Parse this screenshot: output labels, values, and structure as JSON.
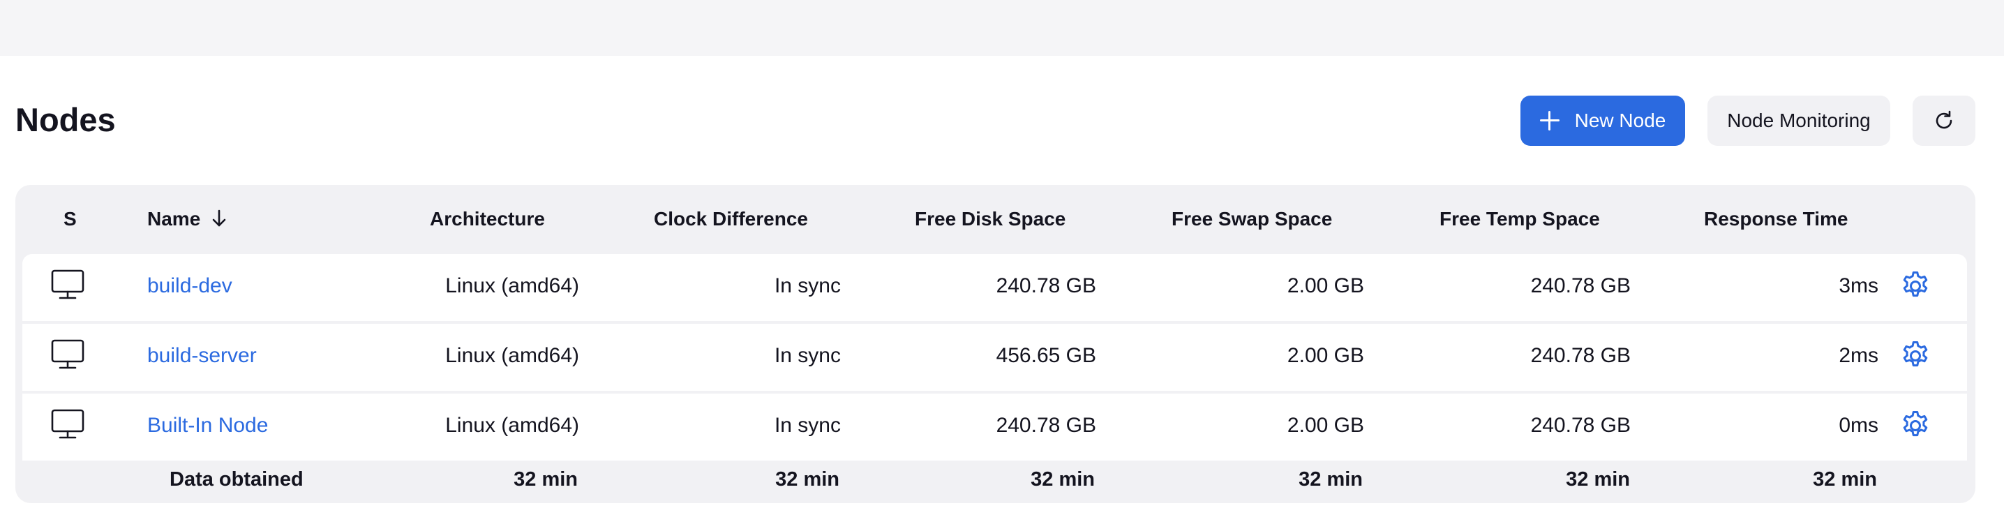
{
  "header": {
    "title": "Nodes",
    "new_node_label": "New Node",
    "monitoring_label": "Node Monitoring",
    "refresh_icon": "refresh-icon",
    "new_icon": "plus-icon"
  },
  "accent_color": "#2b6ae0",
  "table": {
    "columns": {
      "status": "S",
      "name": "Name",
      "architecture": "Architecture",
      "clock": "Clock Difference",
      "disk": "Free Disk Space",
      "swap": "Free Swap Space",
      "temp": "Free Temp Space",
      "response": "Response Time"
    },
    "sort_icon": "arrow-down-icon",
    "rows": [
      {
        "status_icon": "computer-icon",
        "name": "build-dev",
        "architecture": "Linux (amd64)",
        "clock": "In sync",
        "disk": "240.78 GB",
        "swap": "2.00 GB",
        "temp": "240.78 GB",
        "response": "3ms",
        "action_icon": "gear-icon"
      },
      {
        "status_icon": "computer-icon",
        "name": "build-server",
        "architecture": "Linux (amd64)",
        "clock": "In sync",
        "disk": "456.65 GB",
        "swap": "2.00 GB",
        "temp": "240.78 GB",
        "response": "2ms",
        "action_icon": "gear-icon"
      },
      {
        "status_icon": "computer-icon",
        "name": "Built-In Node",
        "architecture": "Linux (amd64)",
        "clock": "In sync",
        "disk": "240.78 GB",
        "swap": "2.00 GB",
        "temp": "240.78 GB",
        "response": "0ms",
        "action_icon": "gear-icon"
      }
    ],
    "footer": {
      "label": "Data obtained",
      "architecture": "32 min",
      "clock": "32 min",
      "disk": "32 min",
      "swap": "32 min",
      "temp": "32 min",
      "response": "32 min"
    }
  }
}
